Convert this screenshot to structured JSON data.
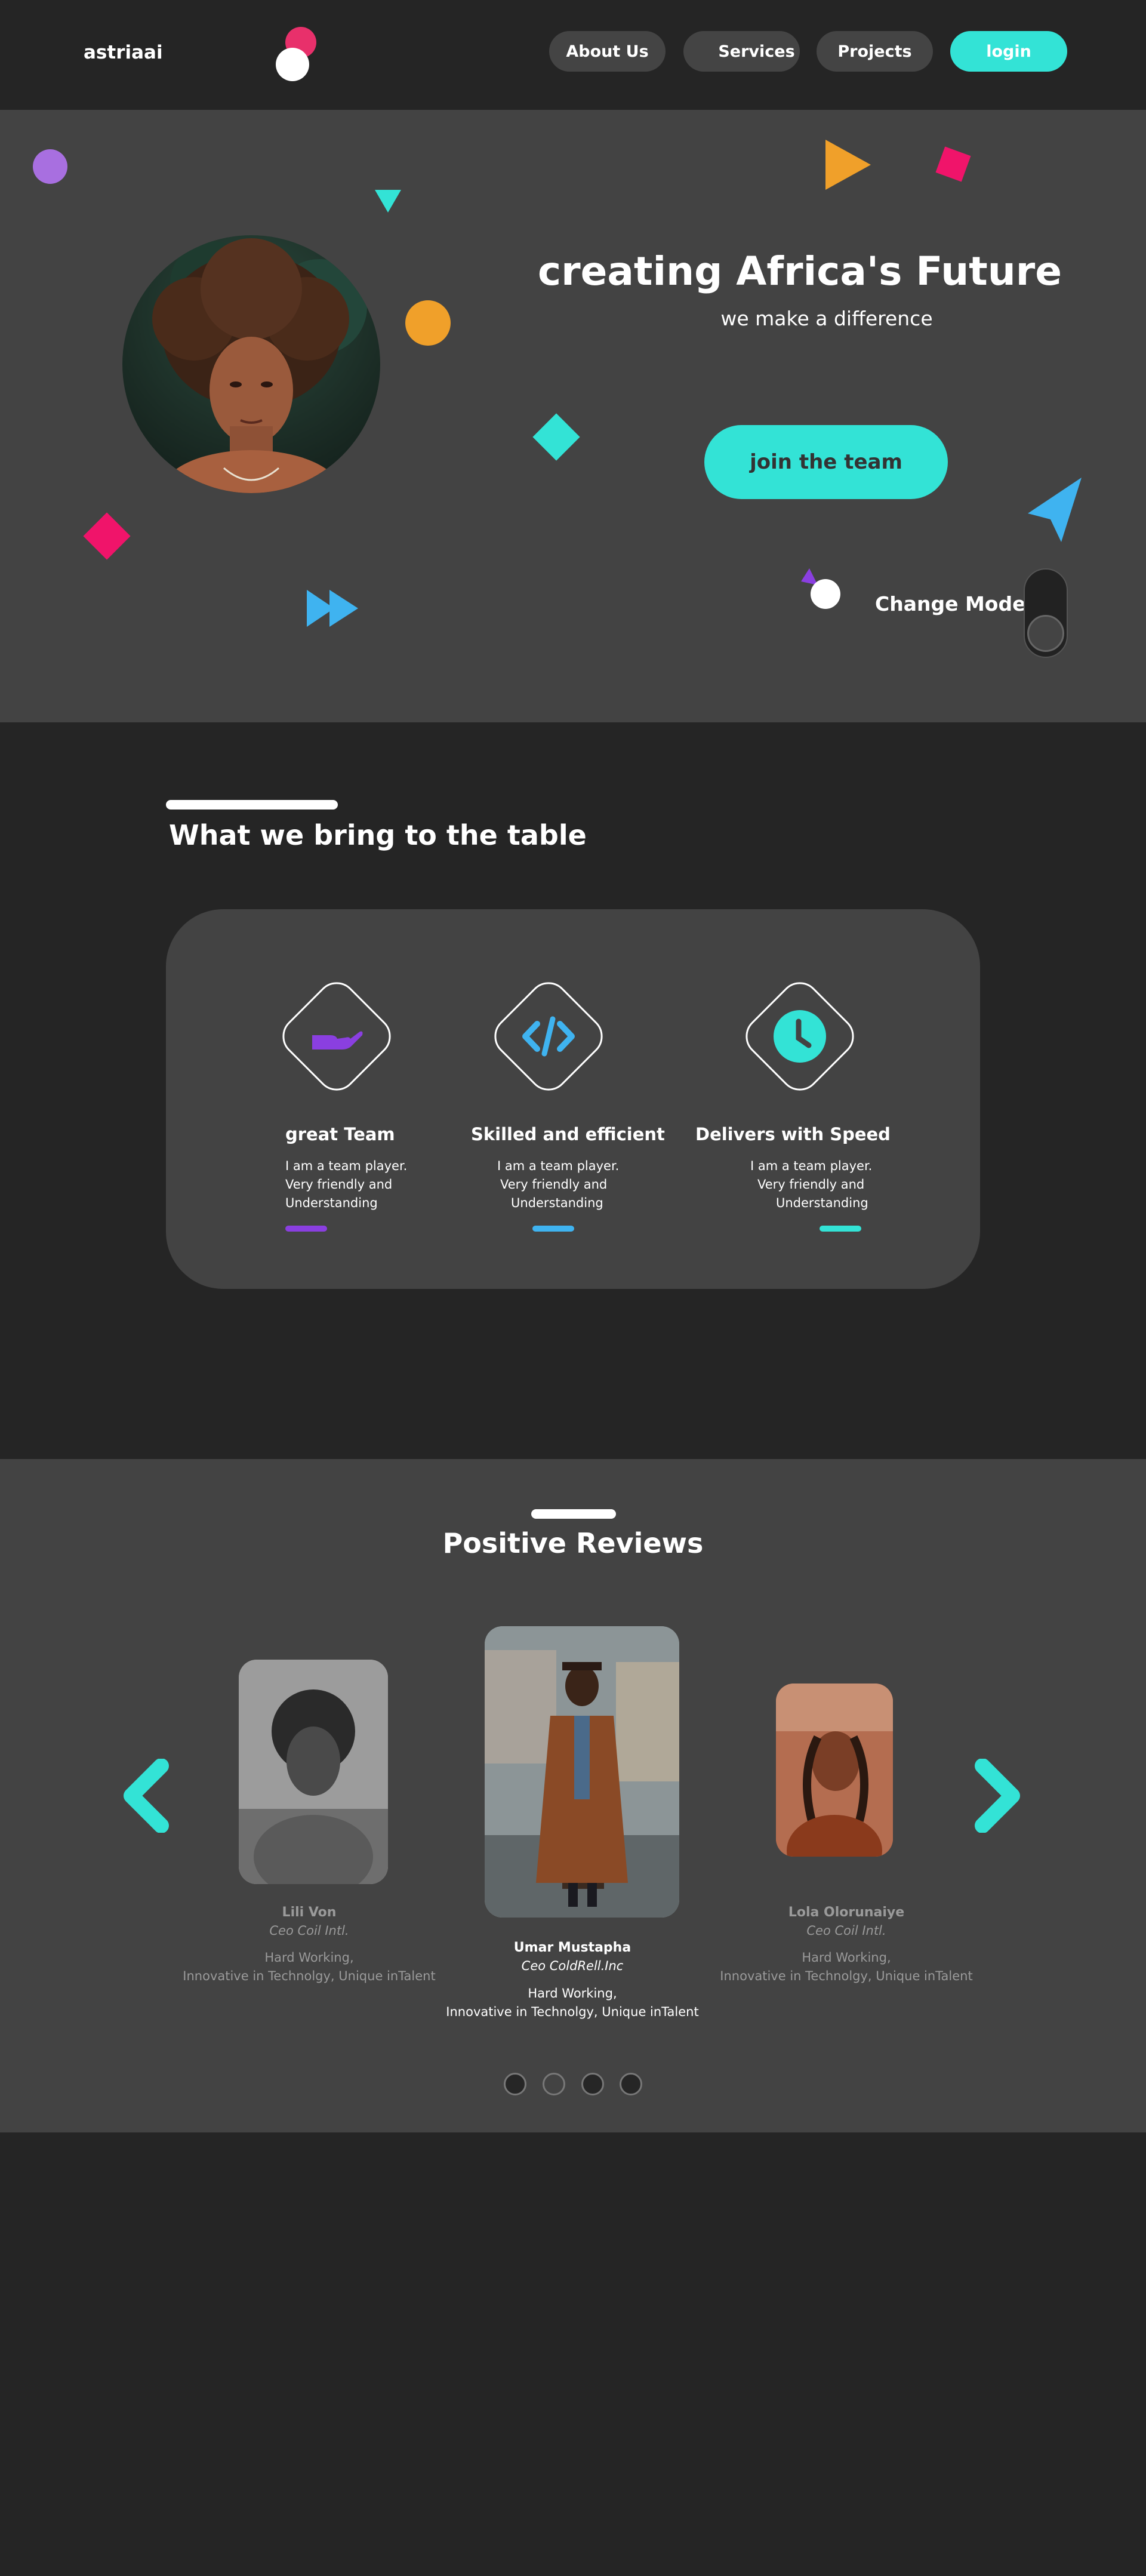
{
  "nav": {
    "brand": "astriaai",
    "items": [
      "About Us",
      "Services",
      "Projects"
    ],
    "login": "login"
  },
  "hero": {
    "title": "creating Africa's Future",
    "subtitle": "we make a difference",
    "cta": "join the team",
    "mode_label": "Change Mode"
  },
  "features": {
    "title": "What we bring to the table",
    "items": [
      {
        "title": "great Team",
        "lines": [
          "I am a team player.",
          "Very friendly and",
          "Understanding"
        ],
        "icon": "hand-icon",
        "color": "#8a3fe0"
      },
      {
        "title": "Skilled and efficient",
        "lines": [
          "I am a team player.",
          "Very friendly and",
          "Understanding"
        ],
        "icon": "code-icon",
        "color": "#3fb3f0"
      },
      {
        "title": "Delivers with Speed",
        "lines": [
          "I am a team player.",
          "Very friendly and",
          "Understanding"
        ],
        "icon": "clock-icon",
        "color": "#33e3d6"
      }
    ]
  },
  "reviews": {
    "title": "Positive Reviews",
    "items": [
      {
        "name": "Lili Von",
        "role": "Ceo Coil  Intl.",
        "line1": "Hard Working,",
        "line2": "Innovative in Technolgy, Unique inTalent"
      },
      {
        "name": "Umar Mustapha",
        "role": "Ceo ColdRell.Inc",
        "line1": "Hard Working,",
        "line2": "Innovative in Technolgy, Unique inTalent"
      },
      {
        "name": "Lola Olorunaiye",
        "role": "Ceo Coil  Intl.",
        "line1": "Hard Working,",
        "line2": "Innovative in Technolgy, Unique inTalent"
      }
    ]
  },
  "colors": {
    "accent": "#33e3d6",
    "pink": "#f0146a",
    "orange": "#f0a02a",
    "purple": "#8a3fe0",
    "blue": "#3fb3f0"
  }
}
